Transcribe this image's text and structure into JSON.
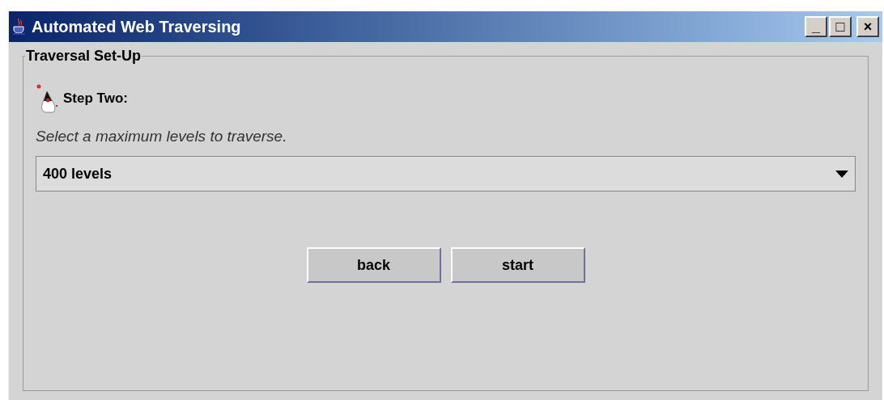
{
  "window": {
    "title": "Automated Web Traversing",
    "controls": [
      "_",
      "□",
      "×"
    ]
  },
  "group": {
    "title": "Traversal Set-Up",
    "step": "Step Two:",
    "instruction": "Select a maximum levels to traverse.",
    "dropdown": {
      "value": "400 levels"
    },
    "buttons": [
      "back",
      "start"
    ]
  }
}
